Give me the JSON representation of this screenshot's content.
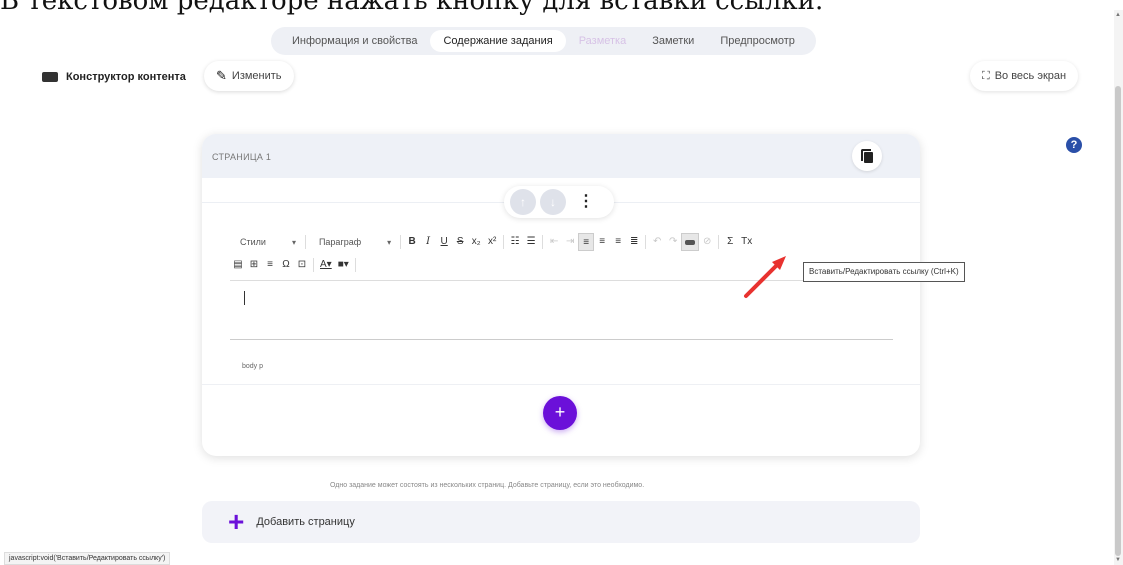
{
  "caption": "В текстовом редакторе нажать кнопку для вставки ссылки.",
  "tabs": [
    {
      "label": "Информация и свойства",
      "state": "normal"
    },
    {
      "label": "Содержание задания",
      "state": "active"
    },
    {
      "label": "Разметка",
      "state": "disabled"
    },
    {
      "label": "Заметки",
      "state": "normal"
    },
    {
      "label": "Предпросмотр",
      "state": "normal"
    }
  ],
  "toolbar_top": {
    "builder_label": "Конструктор контента",
    "edit_label": "Изменить",
    "fullscreen_label": "Во весь экран"
  },
  "help_label": "?",
  "page_card": {
    "title": "СТРАНИЦА 1",
    "editor": {
      "styles_select": "Стили",
      "format_select": "Параграф",
      "status_path": "body  p"
    }
  },
  "tooltip": "Вставить/Редактировать ссылку (Ctrl+K)",
  "hint": "Одно задание может состоять из нескольких страниц. Добавьте страницу, если это необходимо.",
  "add_page_label": "Добавить страницу",
  "status_url": "javascript:void('Вставить/Редактировать ссылку')",
  "colors": {
    "accent": "#6b10d9",
    "help": "#2a4fa8",
    "arrow": "#e8322f"
  },
  "icons": {
    "bold": "B",
    "italic": "I",
    "underline": "U",
    "strike": "S",
    "subscript": "x₂",
    "superscript": "x²",
    "omega": "Ω",
    "sigma": "Σ",
    "add": "+"
  }
}
